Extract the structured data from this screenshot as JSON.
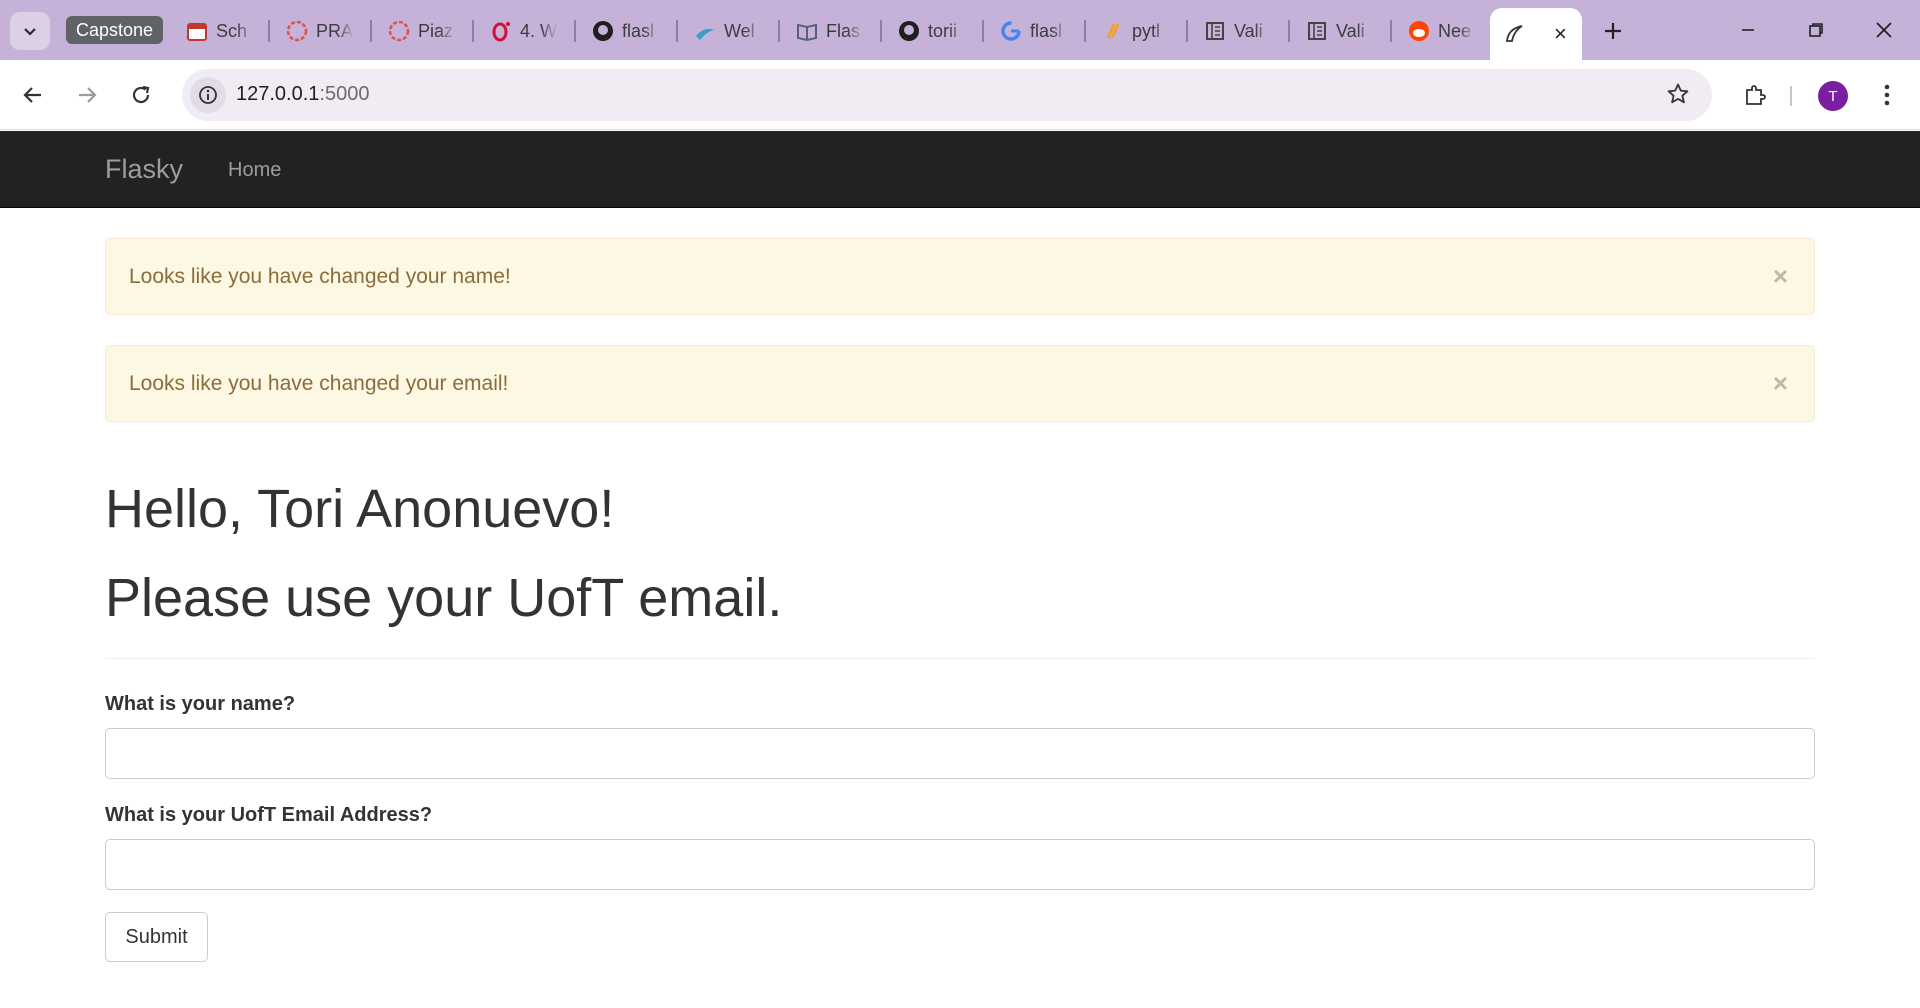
{
  "browser": {
    "tab_group_label": "Capstone",
    "tabs": [
      {
        "title": "Sch",
        "icon": "calendar-icon"
      },
      {
        "title": "PRA",
        "icon": "piazza-icon"
      },
      {
        "title": "Piaz",
        "icon": "piazza-icon"
      },
      {
        "title": "4. W",
        "icon": "opera-icon"
      },
      {
        "title": "flasl",
        "icon": "github-icon"
      },
      {
        "title": "Wel",
        "icon": "flask-icon"
      },
      {
        "title": "Flas",
        "icon": "book-icon"
      },
      {
        "title": "torii",
        "icon": "github-icon"
      },
      {
        "title": "flasl",
        "icon": "google-icon"
      },
      {
        "title": "pytl",
        "icon": "python-icon"
      },
      {
        "title": "Vali",
        "icon": "docs-icon"
      },
      {
        "title": "Vali",
        "icon": "docs-icon"
      },
      {
        "title": "Nee",
        "icon": "reddit-icon"
      }
    ],
    "active_tab": {
      "icon": "flask-horn-icon",
      "close_glyph": "×"
    },
    "url_host": "127.0.0.1",
    "url_port": ":5000",
    "profile_initial": "T",
    "accent_color": "#c6b2d8"
  },
  "navbar": {
    "brand": "Flasky",
    "links": [
      "Home"
    ]
  },
  "alerts": [
    {
      "message": "Looks like you have changed your name!",
      "close": "×"
    },
    {
      "message": "Looks like you have changed your email!",
      "close": "×"
    }
  ],
  "page": {
    "greeting": "Hello, Tori Anonuevo!",
    "note": "Please use your UofT email."
  },
  "form": {
    "name_label": "What is your name?",
    "name_value": "",
    "email_label": "What is your UofT Email Address?",
    "email_value": "",
    "submit_label": "Submit"
  }
}
